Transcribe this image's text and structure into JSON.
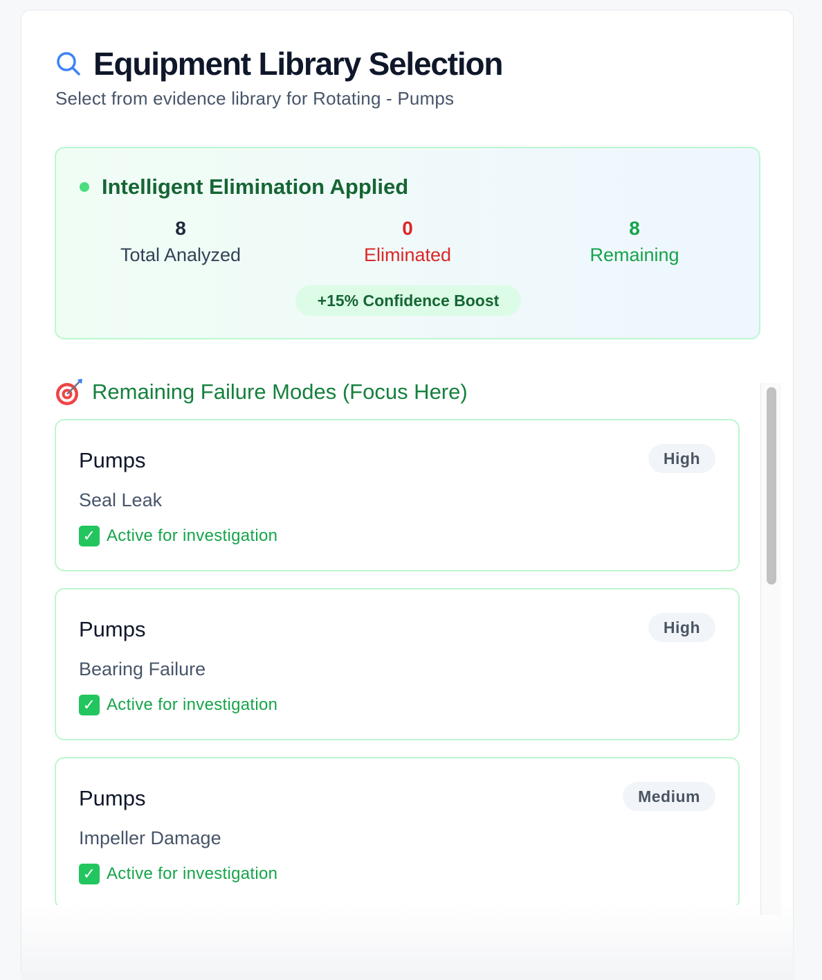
{
  "header": {
    "title": "Equipment Library Selection",
    "subtitle": "Select from evidence library for Rotating - Pumps",
    "icon": "search-icon"
  },
  "elimination": {
    "title": "Intelligent Elimination Applied",
    "stats": {
      "total": {
        "value": "8",
        "label": "Total Analyzed"
      },
      "eliminated": {
        "value": "0",
        "label": "Eliminated"
      },
      "remaining": {
        "value": "8",
        "label": "Remaining"
      }
    },
    "boost": "+15% Confidence Boost",
    "colors": {
      "total": "#1e293b",
      "eliminated": "#dc2626",
      "remaining": "#16a34a"
    }
  },
  "remaining_section": {
    "title": "Remaining Failure Modes (Focus Here)",
    "icon": "target-icon",
    "items": [
      {
        "equipment": "Pumps",
        "failure_mode": "Seal Leak",
        "priority": "High",
        "status": "Active for investigation"
      },
      {
        "equipment": "Pumps",
        "failure_mode": "Bearing Failure",
        "priority": "High",
        "status": "Active for investigation"
      },
      {
        "equipment": "Pumps",
        "failure_mode": "Impeller Damage",
        "priority": "Medium",
        "status": "Active for investigation"
      }
    ]
  }
}
